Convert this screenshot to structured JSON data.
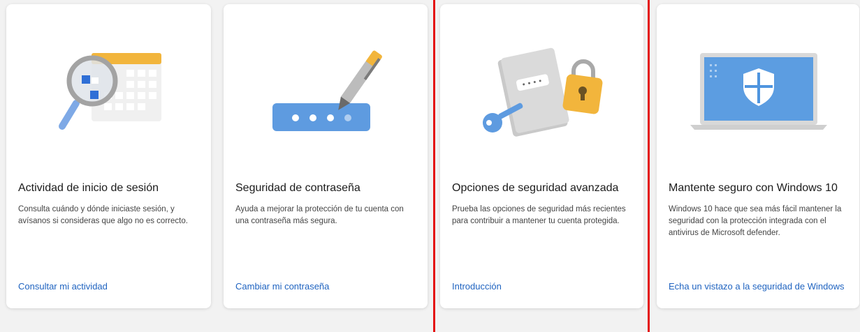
{
  "cards": [
    {
      "title": "Actividad de inicio de sesión",
      "description": "Consulta cuándo y dónde iniciaste sesión, y avísanos si consideras que algo no es correcto.",
      "link": "Consultar mi actividad",
      "icon": "magnifier-calendar-icon"
    },
    {
      "title": "Seguridad de contraseña",
      "description": "Ayuda a mejorar la protección de tu cuenta con una contraseña más segura.",
      "link": "Cambiar mi contraseña",
      "icon": "password-pen-icon"
    },
    {
      "title": "Opciones de seguridad avanzada",
      "description": "Prueba las opciones de seguridad más recientes para contribuir a mantener tu cuenta protegida.",
      "link": "Introducción",
      "icon": "key-lock-book-icon"
    },
    {
      "title": "Mantente seguro con Windows 10",
      "description": "Windows 10 hace que sea más fácil mantener la seguridad con la protección integrada con el antivirus de Microsoft defender.",
      "link": "Echa un vistazo a la seguridad de Windows",
      "icon": "laptop-shield-icon"
    }
  ],
  "colors": {
    "link": "#1f63c0",
    "highlight": "#e41212",
    "accent_yellow": "#f2b53c",
    "accent_blue": "#5e9be0"
  }
}
